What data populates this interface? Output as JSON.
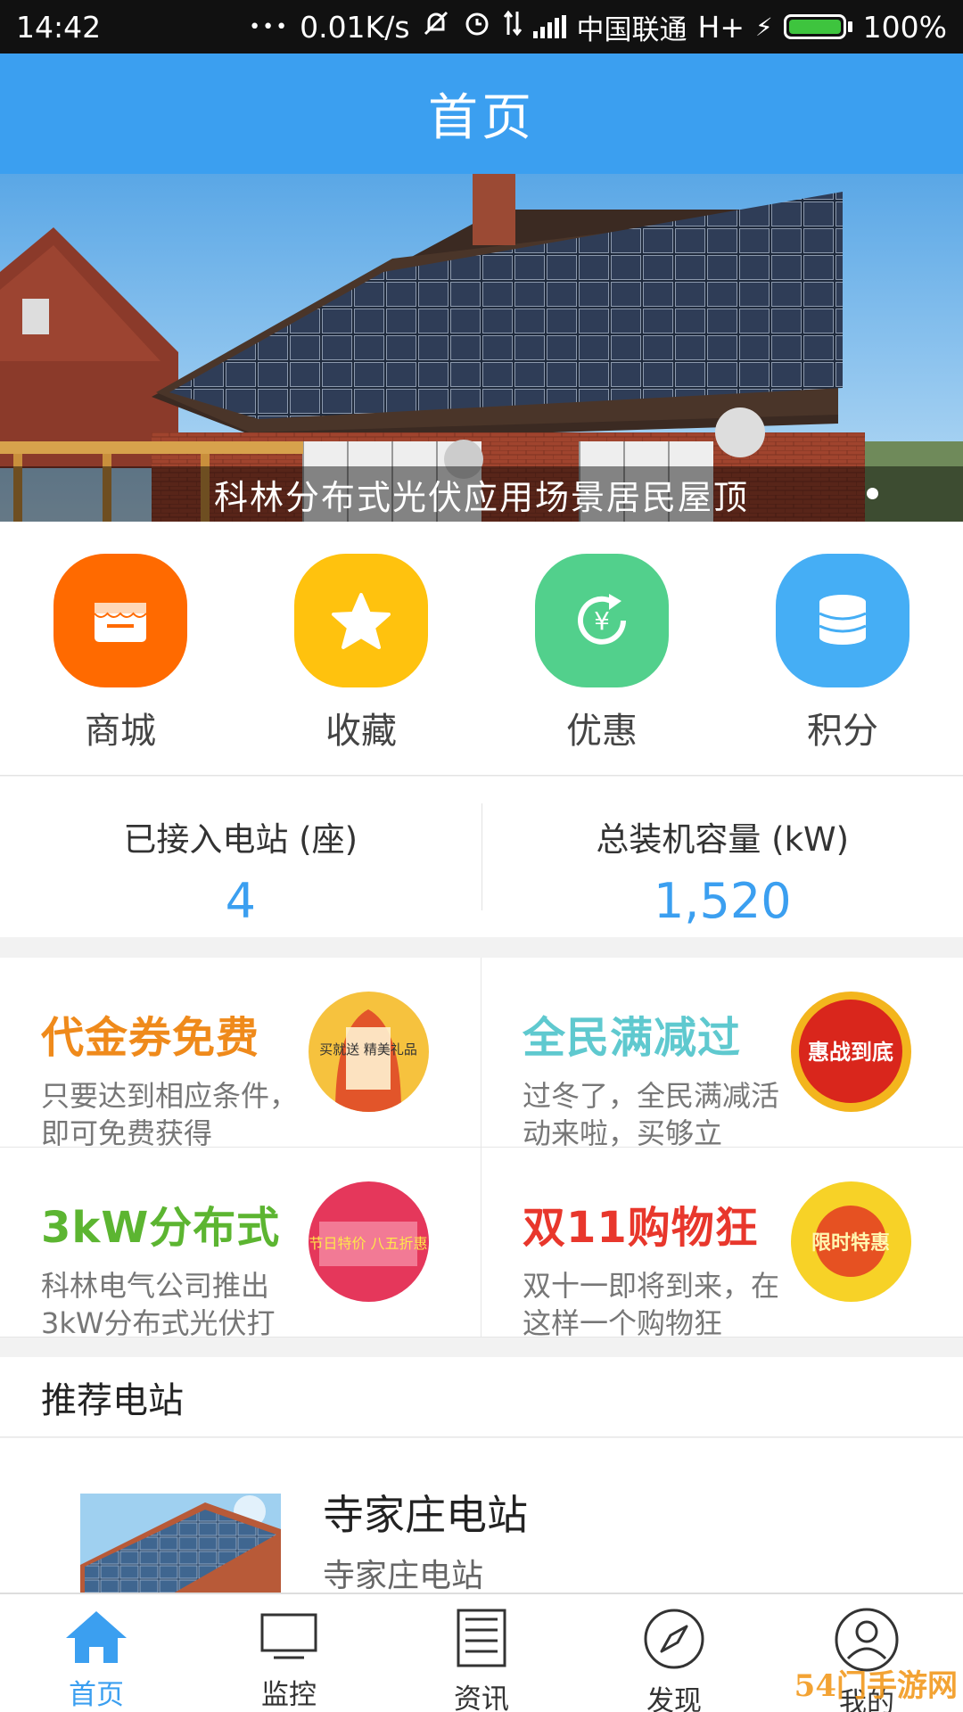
{
  "status_bar": {
    "time": "14:42",
    "dots": "•••",
    "net_speed": "0.01K/s",
    "carrier": "中国联通",
    "network": "H+",
    "battery": "100%"
  },
  "header": {
    "title": "首页"
  },
  "banner": {
    "caption": "科林分布式光伏应用场景居民屋顶"
  },
  "quick_menu": [
    {
      "label": "商城",
      "icon": "store-icon",
      "color": "#ff6a00"
    },
    {
      "label": "收藏",
      "icon": "star-icon",
      "color": "#ffc20e"
    },
    {
      "label": "优惠",
      "icon": "yen-cycle-icon",
      "color": "#52d08c"
    },
    {
      "label": "积分",
      "icon": "coins-icon",
      "color": "#45aef5"
    }
  ],
  "stats": [
    {
      "label": "已接入电站 (座)",
      "value": "4"
    },
    {
      "label": "总装机容量 (kW)",
      "value": "1,520"
    }
  ],
  "promos": [
    {
      "title": "代金券免费",
      "desc": "只要达到相应条件，即可免费获得",
      "color": "#ef8a1b",
      "img_text": "买就送 精美礼品"
    },
    {
      "title": "全民满减过",
      "desc": "过冬了，全民满减活动来啦，买够立",
      "color": "#5fc9cf",
      "img_text": "惠战到底"
    },
    {
      "title": "3kW分布式",
      "desc": "科林电气公司推出3kW分布式光伏打",
      "color": "#5cb531",
      "img_text": "节日特价 八五折惠"
    },
    {
      "title": "双11购物狂",
      "desc": "双十一即将到来，在这样一个购物狂",
      "color": "#e8372c",
      "img_text": "限时特惠"
    }
  ],
  "recommend": {
    "title": "推荐电站",
    "items": [
      {
        "name": "寺家庄电站",
        "desc": "寺家庄电站"
      }
    ]
  },
  "bottom_nav": [
    {
      "label": "首页",
      "icon": "home-icon",
      "active": true
    },
    {
      "label": "监控",
      "icon": "monitor-icon",
      "active": false
    },
    {
      "label": "资讯",
      "icon": "news-icon",
      "active": false
    },
    {
      "label": "发现",
      "icon": "compass-icon",
      "active": false
    },
    {
      "label": "我的",
      "icon": "user-icon",
      "active": false
    }
  ],
  "watermark": "54门手游网",
  "colors": {
    "primary": "#3b9ff0",
    "status_bar": "#111111"
  }
}
